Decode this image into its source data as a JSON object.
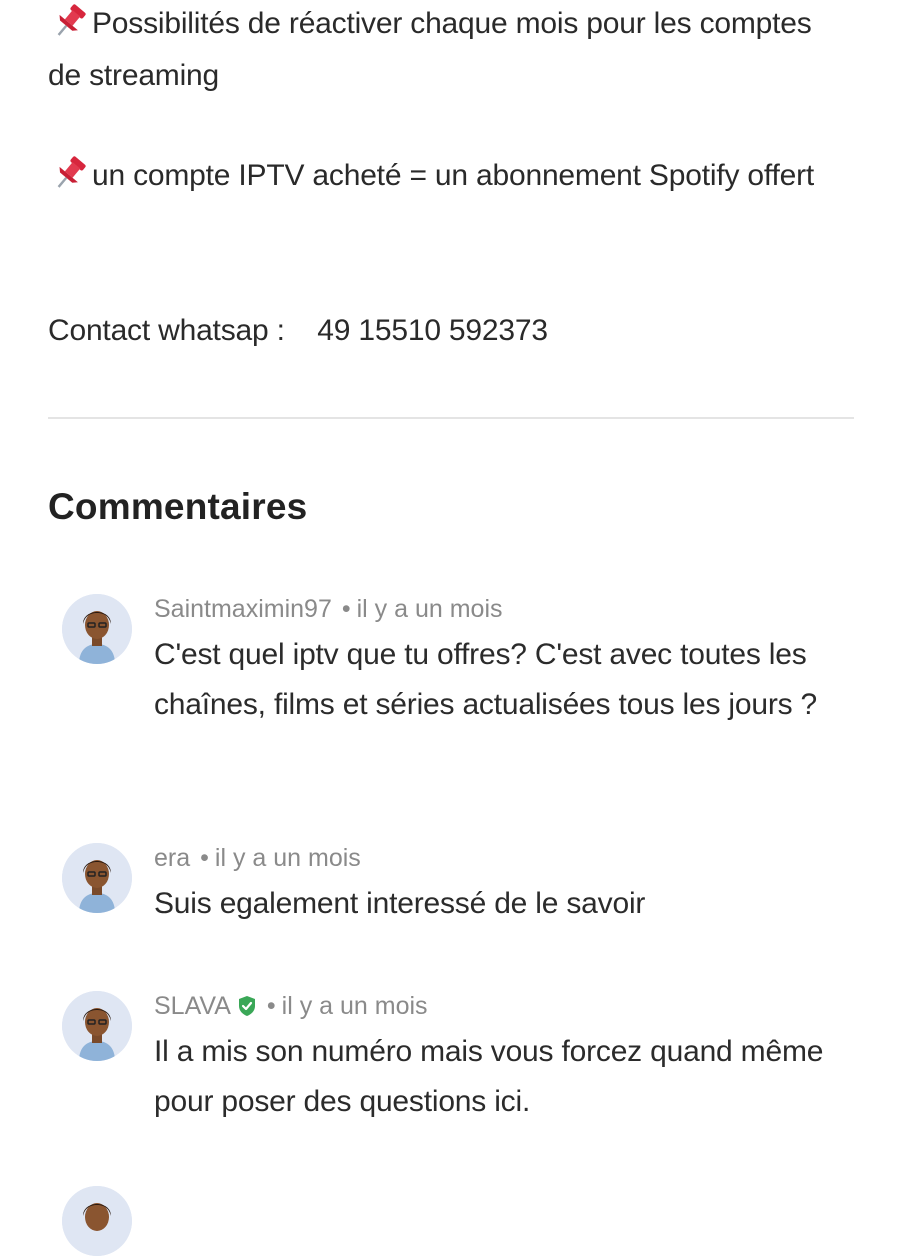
{
  "post": {
    "paragraphs": [
      {
        "text": "Possibilités de réactiver chaque mois pour les comptes de streaming",
        "icon": "pushpin-icon"
      },
      {
        "text": "un compte IPTV acheté = un abonnement Spotify offert",
        "icon": "pushpin-icon"
      },
      {
        "text": "Contact whatsap :    49 15510 592373"
      }
    ]
  },
  "comments": {
    "title": "Commentaires",
    "items": [
      {
        "author": "Saintmaximin97",
        "time": "il y a un mois",
        "text": "C'est quel iptv que tu offres? C'est avec toutes les chaînes, films et séries actualisées tous les jours ?",
        "verified": false
      },
      {
        "author": "era",
        "time": "il y a un mois",
        "text": "Suis egalement interessé de le savoir",
        "verified": false
      },
      {
        "author": "SLAVA",
        "time": "il y a un mois",
        "text": "Il a mis son numéro mais vous forcez quand même pour poser des questions ici.",
        "verified": true
      }
    ]
  },
  "colors": {
    "verified_green": "#3aa757",
    "pin_red": "#d7263d",
    "divider": "#e4e4e4"
  }
}
